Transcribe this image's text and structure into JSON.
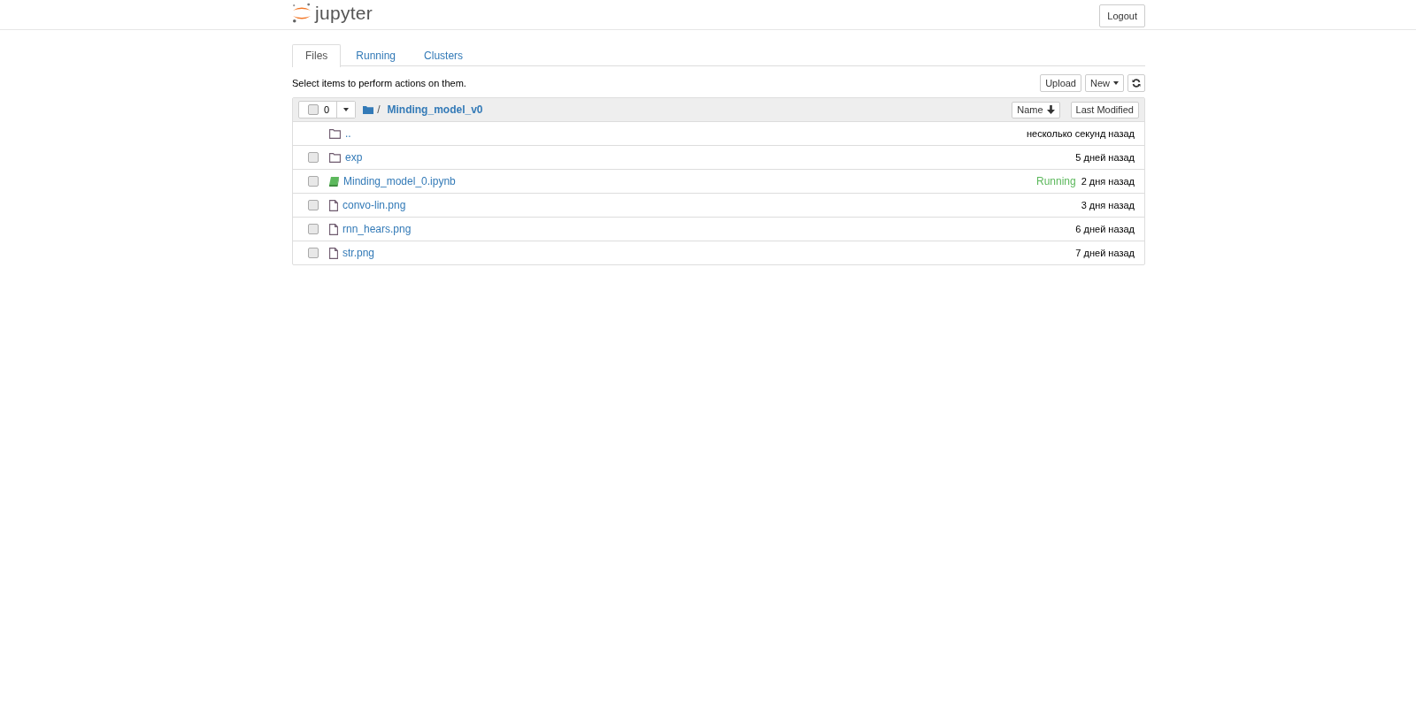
{
  "header": {
    "logo_text": "jupyter",
    "logout": "Logout"
  },
  "tabs": [
    {
      "label": "Files",
      "selected": true
    },
    {
      "label": "Running",
      "selected": false
    },
    {
      "label": "Clusters",
      "selected": false
    }
  ],
  "toolbar": {
    "hint": "Select items to perform actions on them.",
    "upload": "Upload",
    "new": "New"
  },
  "list_header": {
    "selected_count": "0",
    "checked": false,
    "separator": "/",
    "path": "Minding_model_v0",
    "sort_name": "Name",
    "sort_modified": "Last Modified"
  },
  "rows": [
    {
      "kind": "parent",
      "name": "..",
      "modified": "несколько секунд назад"
    },
    {
      "kind": "folder",
      "name": "exp",
      "modified": "5 дней назад",
      "checked": false
    },
    {
      "kind": "notebook",
      "name": "Minding_model_0.ipynb",
      "status": "Running",
      "modified": "2 дня назад",
      "checked": false
    },
    {
      "kind": "file",
      "name": "convo-lin.png",
      "modified": "3 дня назад",
      "checked": false
    },
    {
      "kind": "file",
      "name": "rnn_hears.png",
      "modified": "6 дней назад",
      "checked": false
    },
    {
      "kind": "file",
      "name": "str.png",
      "modified": "7 дней назад",
      "checked": false
    }
  ]
}
